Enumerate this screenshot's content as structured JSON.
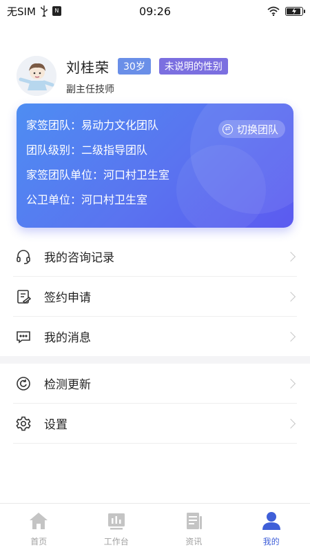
{
  "status_bar": {
    "carrier": "无SIM",
    "time": "09:26"
  },
  "profile": {
    "name": "刘桂荣",
    "age_tag": "30岁",
    "gender_tag": "未说明的性别",
    "title": "副主任技师"
  },
  "team_card": {
    "switch_label": "切换团队",
    "rows": [
      {
        "label": "家签团队：",
        "value": "易动力文化团队"
      },
      {
        "label": "团队级别：",
        "value": "二级指导团队"
      },
      {
        "label": "家签团队单位：",
        "value": "河口村卫生室"
      },
      {
        "label": "公卫单位：",
        "value": "河口村卫生室"
      }
    ],
    "colors": {
      "start": "#4e8df2",
      "end": "#5b5af0"
    }
  },
  "menu": {
    "group1": [
      {
        "label": "我的咨询记录",
        "icon": "headset-icon"
      },
      {
        "label": "签约申请",
        "icon": "document-icon"
      },
      {
        "label": "我的消息",
        "icon": "message-icon"
      }
    ],
    "group2": [
      {
        "label": "检测更新",
        "icon": "refresh-icon"
      },
      {
        "label": "设置",
        "icon": "gear-icon"
      }
    ]
  },
  "bottom_nav": {
    "items": [
      {
        "label": "首页",
        "icon": "home-icon"
      },
      {
        "label": "工作台",
        "icon": "workbench-icon"
      },
      {
        "label": "资讯",
        "icon": "news-icon"
      },
      {
        "label": "我的",
        "icon": "user-icon"
      }
    ],
    "active_index": 3,
    "active_color": "#3f5fd8",
    "inactive_color": "#c4c4c4"
  }
}
